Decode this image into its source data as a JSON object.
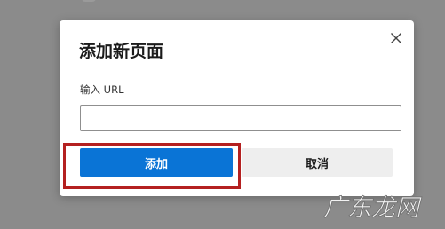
{
  "dialog": {
    "title": "添加新页面",
    "close_icon": "close-icon",
    "url_label": "输入 URL",
    "url_value": "",
    "url_placeholder": "",
    "add_label": "添加",
    "cancel_label": "取消"
  },
  "watermark": {
    "text": "广东龙网"
  },
  "colors": {
    "primary_button": "#0a74d6",
    "secondary_button": "#eeeeee",
    "highlight_border": "#b42020",
    "backdrop": "#8b8b8b"
  }
}
